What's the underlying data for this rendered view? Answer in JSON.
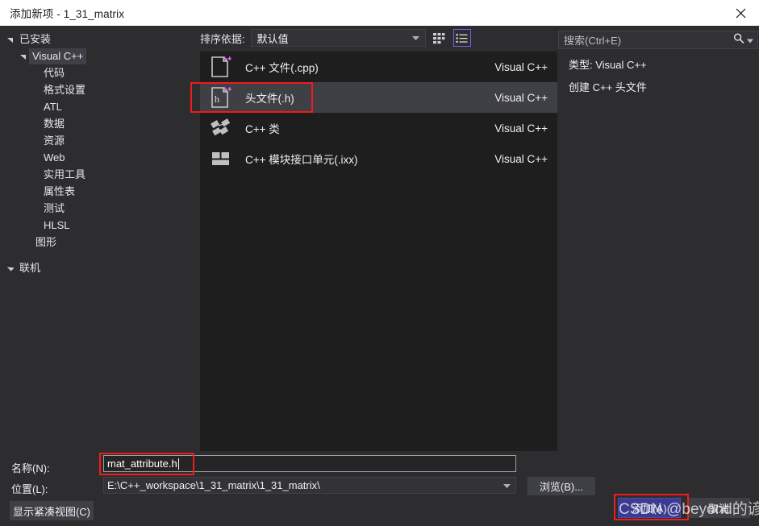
{
  "window": {
    "title": "添加新项 - 1_31_matrix",
    "close_icon": "close-icon"
  },
  "sidebar": {
    "root": {
      "label": "已安装",
      "expander": "chevron-down-icon"
    },
    "items": [
      {
        "label": "Visual C++",
        "level": 1,
        "expander": "chevron-down-icon",
        "selected": true
      },
      {
        "label": "代码",
        "level": 2,
        "expander": "",
        "selected": false
      },
      {
        "label": "格式设置",
        "level": 2,
        "expander": "",
        "selected": false
      },
      {
        "label": "ATL",
        "level": 2,
        "expander": "",
        "selected": false
      },
      {
        "label": "数据",
        "level": 2,
        "expander": "",
        "selected": false
      },
      {
        "label": "资源",
        "level": 2,
        "expander": "",
        "selected": false
      },
      {
        "label": "Web",
        "level": 2,
        "expander": "",
        "selected": false
      },
      {
        "label": "实用工具",
        "level": 2,
        "expander": "",
        "selected": false
      },
      {
        "label": "属性表",
        "level": 2,
        "expander": "",
        "selected": false
      },
      {
        "label": "测试",
        "level": 2,
        "expander": "",
        "selected": false
      },
      {
        "label": "HLSL",
        "level": 2,
        "expander": "",
        "selected": false
      },
      {
        "label": "图形",
        "level": 1,
        "expander": "",
        "selected": false
      }
    ],
    "online": {
      "label": "联机",
      "expander": "chevron-right-icon"
    }
  },
  "toolbar": {
    "sort_label": "排序依据:",
    "sort_value": "默认值",
    "sort_caret": "chevron-down-icon",
    "grid_view_icon": "grid-view-icon",
    "list_view_icon": "list-view-icon",
    "active_view": "list"
  },
  "list": {
    "items": [
      {
        "label": "C++ 文件(.cpp)",
        "source": "Visual C++",
        "icon": "cpp-file-icon",
        "selected": false
      },
      {
        "label": "头文件(.h)",
        "source": "Visual C++",
        "icon": "header-file-icon",
        "selected": true
      },
      {
        "label": "C++ 类",
        "source": "Visual C++",
        "icon": "cpp-class-icon",
        "selected": false
      },
      {
        "label": "C++ 模块接口单元(.ixx)",
        "source": "Visual C++",
        "icon": "cpp-module-icon",
        "selected": false
      }
    ]
  },
  "right": {
    "search_placeholder": "搜索(Ctrl+E)",
    "search_icon": "search-icon",
    "search_caret": "chevron-down-icon",
    "detail_lines": [
      "类型: Visual C++",
      "创建 C++ 头文件"
    ]
  },
  "form": {
    "name_label": "名称(N):",
    "name_value": "mat_attribute.h",
    "location_label": "位置(L):",
    "location_value": "E:\\C++_workspace\\1_31_matrix\\1_31_matrix\\",
    "location_caret": "chevron-down-icon",
    "browse_label": "浏览(B)...",
    "compact_label": "显示紧凑视图(C)",
    "add_label": "添加(A)",
    "cancel_label": "取消"
  },
  "overlay": {
    "watermark": "CSDN @beyond的谚语",
    "annotation_color": "#f01b1b"
  }
}
